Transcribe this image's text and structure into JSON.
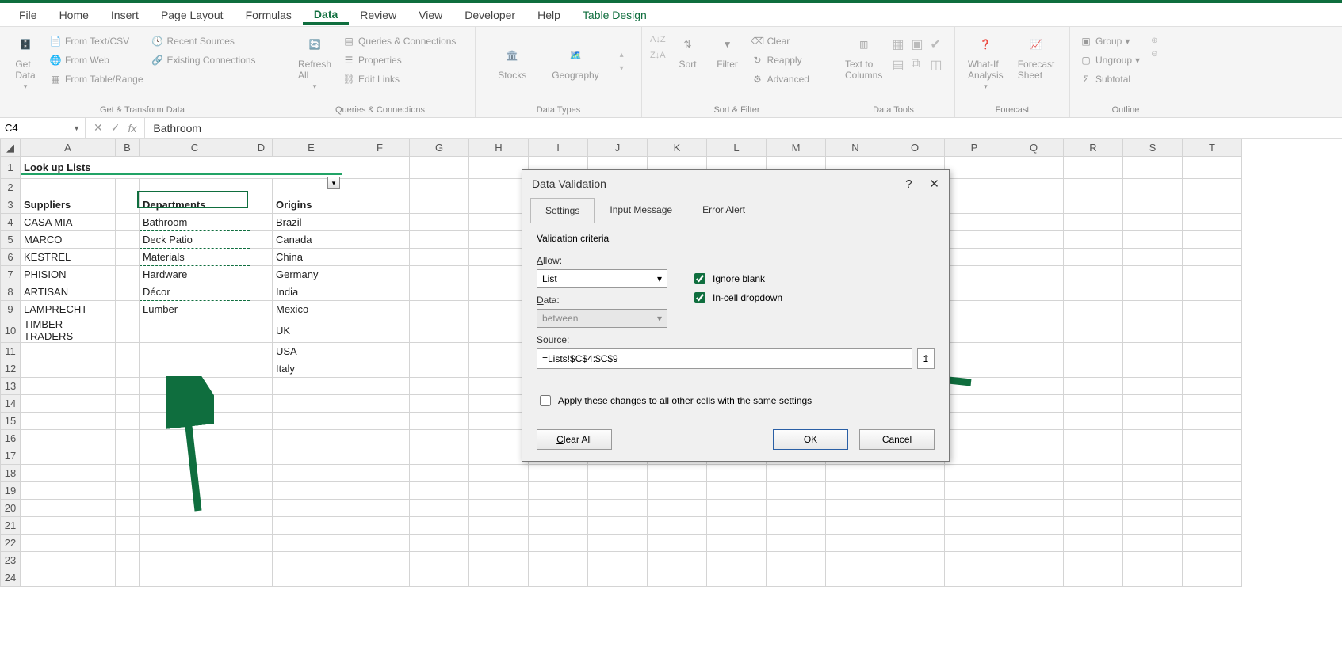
{
  "menu": {
    "items": [
      "File",
      "Home",
      "Insert",
      "Page Layout",
      "Formulas",
      "Data",
      "Review",
      "View",
      "Developer",
      "Help",
      "Table Design"
    ],
    "active": "Data"
  },
  "ribbon": {
    "getTransform": {
      "main": "Get\nData",
      "items": [
        "From Text/CSV",
        "From Web",
        "From Table/Range",
        "Recent Sources",
        "Existing Connections"
      ],
      "label": "Get & Transform Data"
    },
    "queries": {
      "main": "Refresh\nAll",
      "items": [
        "Queries & Connections",
        "Properties",
        "Edit Links"
      ],
      "label": "Queries & Connections"
    },
    "datatypes": {
      "items": [
        "Stocks",
        "Geography"
      ],
      "label": "Data Types"
    },
    "sortfilter": {
      "sort": "Sort",
      "filter": "Filter",
      "items": [
        "Clear",
        "Reapply",
        "Advanced"
      ],
      "label": "Sort & Filter"
    },
    "datatools": {
      "main": "Text to\nColumns",
      "label": "Data Tools"
    },
    "forecast": {
      "whatif": "What-If\nAnalysis",
      "sheet": "Forecast\nSheet",
      "label": "Forecast"
    },
    "outline": {
      "items": [
        "Group",
        "Ungroup",
        "Subtotal"
      ],
      "label": "Outline"
    }
  },
  "namebox": "C4",
  "formula_value": "Bathroom",
  "columns": [
    "A",
    "B",
    "C",
    "D",
    "E",
    "F",
    "G",
    "H",
    "I",
    "J",
    "K",
    "L",
    "M",
    "N",
    "O",
    "P",
    "Q",
    "R",
    "S",
    "T"
  ],
  "sheet": {
    "title": "Look up Lists",
    "headers": {
      "suppliers": "Suppliers",
      "departments": "Departments",
      "origins": "Origins"
    },
    "suppliers": [
      "CASA MIA",
      "MARCO",
      "KESTREL",
      "PHISION",
      "ARTISAN",
      "LAMPRECHT",
      "TIMBER TRADERS"
    ],
    "departments": [
      "Bathroom",
      "Deck Patio",
      "Materials",
      "Hardware",
      "Décor",
      "Lumber"
    ],
    "origins": [
      "Brazil",
      "Canada",
      "China",
      "Germany",
      "India",
      "Mexico",
      "UK",
      "USA",
      "Italy"
    ]
  },
  "dialog": {
    "title": "Data Validation",
    "tabs": [
      "Settings",
      "Input Message",
      "Error Alert"
    ],
    "criteria_label": "Validation criteria",
    "allow_label": "Allow:",
    "allow_value": "List",
    "ignore_blank": "Ignore blank",
    "incell": "In-cell dropdown",
    "data_label": "Data:",
    "data_value": "between",
    "source_label": "Source:",
    "source_value": "=Lists!$C$4:$C$9",
    "apply_label": "Apply these changes to all other cells with the same settings",
    "clear": "Clear All",
    "ok": "OK",
    "cancel": "Cancel"
  }
}
